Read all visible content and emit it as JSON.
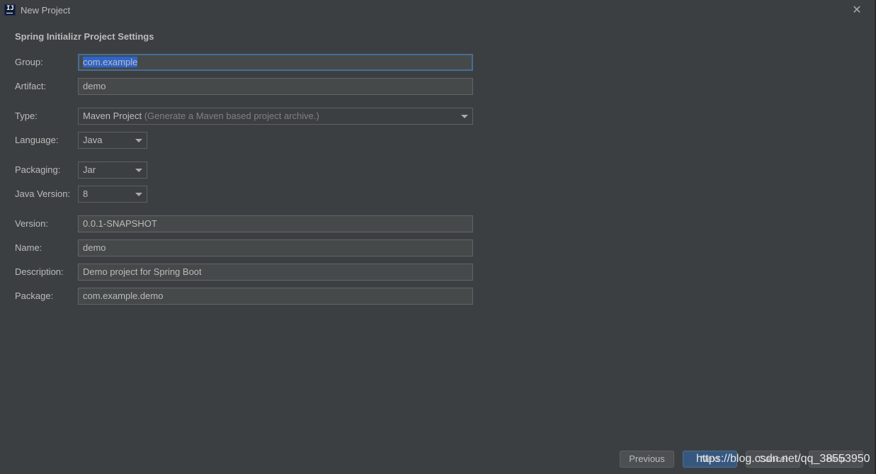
{
  "window": {
    "title": "New Project",
    "logo": "IJ",
    "close_icon": "close-icon"
  },
  "section_title": "Spring Initializr Project Settings",
  "form": {
    "group": {
      "label": "Group:",
      "value": "com.example"
    },
    "artifact": {
      "label": "Artifact:",
      "value": "demo"
    },
    "type": {
      "label": "Type:",
      "value": "Maven Project",
      "hint": "(Generate a Maven based project archive.)"
    },
    "language": {
      "label": "Language:",
      "value": "Java"
    },
    "packaging": {
      "label": "Packaging:",
      "value": "Jar"
    },
    "java_version": {
      "label": "Java Version:",
      "value": "8"
    },
    "version": {
      "label": "Version:",
      "value": "0.0.1-SNAPSHOT"
    },
    "name": {
      "label": "Name:",
      "value": "demo"
    },
    "description": {
      "label": "Description:",
      "value": "Demo project for Spring Boot"
    },
    "package": {
      "label": "Package:",
      "value": "com.example.demo"
    }
  },
  "buttons": {
    "previous": "Previous",
    "next": "Next",
    "cancel": "Cancel",
    "help": "Help"
  },
  "watermark": "https://blog.csdn.net/qq_38553950",
  "colors": {
    "background": "#3c3f41",
    "field_bg": "#45494a",
    "focus_border": "#466d94",
    "selection": "#2f65ca",
    "primary_button": "#365880"
  }
}
